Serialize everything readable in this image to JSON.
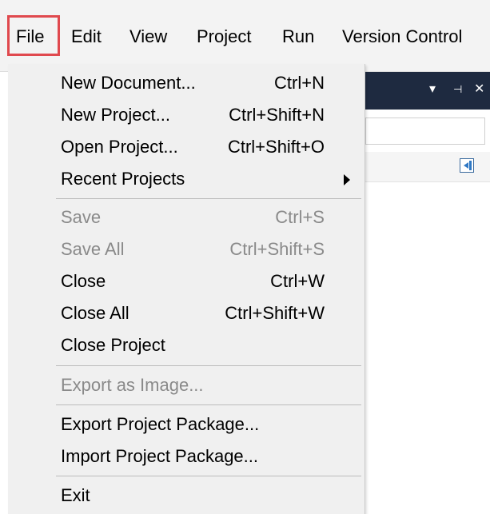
{
  "menubar": {
    "items": [
      {
        "label": "File"
      },
      {
        "label": "Edit"
      },
      {
        "label": "View"
      },
      {
        "label": "Project"
      },
      {
        "label": "Run"
      },
      {
        "label": "Version Control"
      }
    ]
  },
  "panel": {
    "dropdown_icon": "▾",
    "pin_icon": "⊣",
    "close_icon": "✕"
  },
  "file_menu": {
    "new_document": {
      "label": "New Document...",
      "shortcut": "Ctrl+N"
    },
    "new_project": {
      "label": "New Project...",
      "shortcut": "Ctrl+Shift+N"
    },
    "open_project": {
      "label": "Open Project...",
      "shortcut": "Ctrl+Shift+O"
    },
    "recent_projects": {
      "label": "Recent Projects"
    },
    "save": {
      "label": "Save",
      "shortcut": "Ctrl+S"
    },
    "save_all": {
      "label": "Save All",
      "shortcut": "Ctrl+Shift+S"
    },
    "close": {
      "label": "Close",
      "shortcut": "Ctrl+W"
    },
    "close_all": {
      "label": "Close All",
      "shortcut": "Ctrl+Shift+W"
    },
    "close_project": {
      "label": "Close Project"
    },
    "export_image": {
      "label": "Export as Image..."
    },
    "export_package": {
      "label": "Export Project Package..."
    },
    "import_package": {
      "label": "Import Project Package..."
    },
    "exit": {
      "label": "Exit"
    }
  },
  "colors": {
    "highlight_outline": "#e0494e",
    "panel_header": "#1e2a40",
    "menu_background": "#f0f0f0",
    "disabled_text": "#8a8a8a"
  }
}
